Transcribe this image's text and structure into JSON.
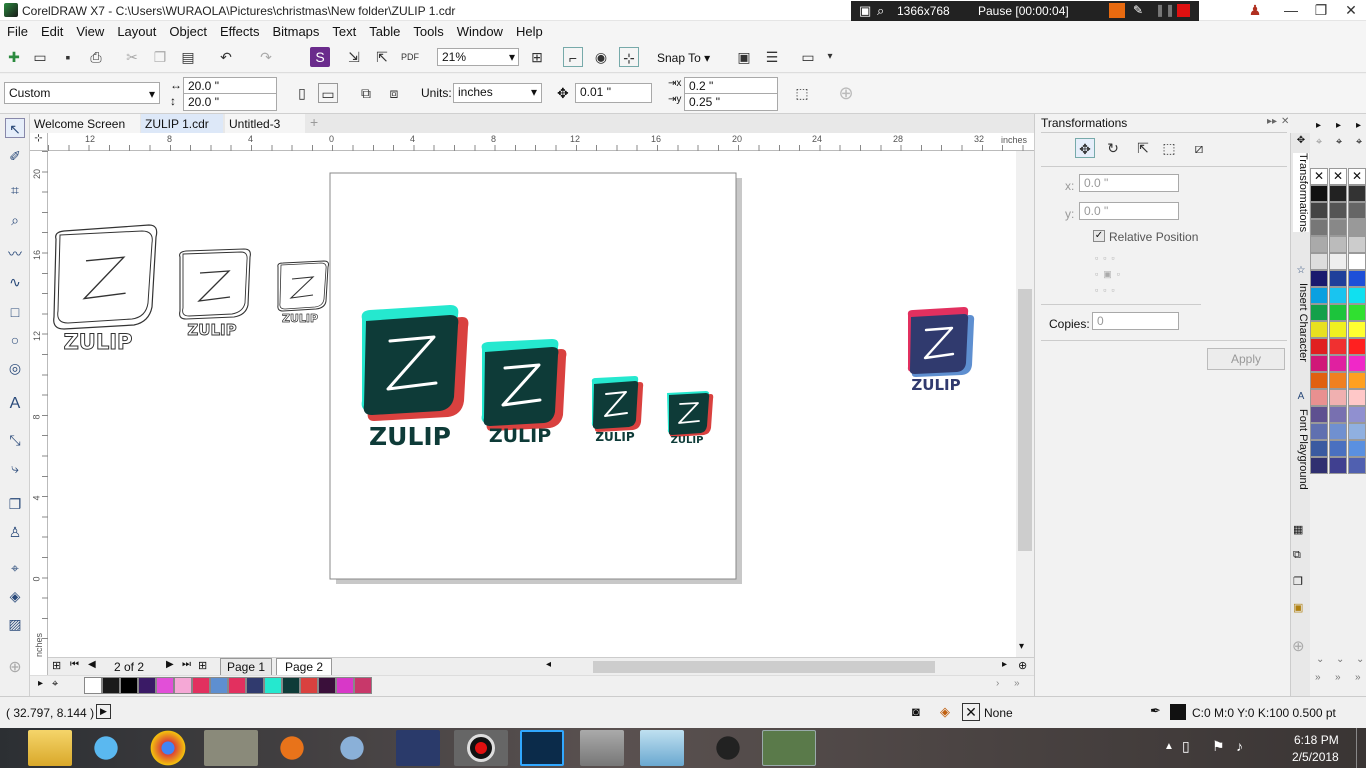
{
  "window": {
    "title": "CorelDRAW X7 - C:\\Users\\WURAOLA\\Pictures\\christmas\\New folder\\ZULIP 1.cdr",
    "recorder_resolution": "1366x768",
    "recorder_status": "Pause [00:00:04]"
  },
  "menu": [
    "File",
    "Edit",
    "View",
    "Layout",
    "Object",
    "Effects",
    "Bitmaps",
    "Text",
    "Table",
    "Tools",
    "Window",
    "Help"
  ],
  "toolbar": {
    "zoom_value": "21%",
    "snap_to_label": "Snap To"
  },
  "property_bar": {
    "preset": "Custom",
    "width": "20.0 \"",
    "height": "20.0 \"",
    "units_label": "Units:",
    "units_value": "inches",
    "nudge": "0.01 \"",
    "dup_x": "0.2 \"",
    "dup_y": "0.25 \""
  },
  "tabs": [
    "Welcome Screen",
    "ZULIP 1.cdr",
    "Untitled-3"
  ],
  "ruler": {
    "unit": "inches",
    "h_ticks": [
      "12",
      "8",
      "4",
      "0",
      "4",
      "8",
      "12",
      "16",
      "20",
      "24",
      "28",
      "32"
    ],
    "v_ticks": [
      "20",
      "16",
      "12",
      "8",
      "4",
      "0"
    ]
  },
  "logos": {
    "text": "ZULIP",
    "colors": {
      "teal": "#25e8cf",
      "dark": "#0e3b38",
      "red": "#d9413f",
      "pink": "#e2305f",
      "navy": "#303a6e",
      "blue": "#5e8fd0"
    }
  },
  "pages": {
    "counter": "2 of 2",
    "items": [
      "Page 1",
      "Page 2"
    ]
  },
  "docker": {
    "title": "Transformations",
    "x_label": "x:",
    "x_value": "0.0 \"",
    "y_label": "y:",
    "y_value": "0.0 \"",
    "relative_label": "Relative Position",
    "copies_label": "Copies:",
    "copies_value": "0",
    "apply_label": "Apply",
    "side_tabs": [
      "Transformations",
      "Insert Character",
      "Font Playground"
    ]
  },
  "status": {
    "coords": "( 32.797, 8.144 )",
    "fill": "None",
    "outline": "C:0 M:0 Y:0 K:100  0.500 pt"
  },
  "taskbar": {
    "time": "6:18 PM",
    "date": "2/5/2018"
  },
  "doc_palette": [
    "#ffffff",
    "#1a1a1a",
    "#000000",
    "#3a1a66",
    "#e24fd8",
    "#f5a8d6",
    "#e2305f",
    "#5e8fd0",
    "#e2305f",
    "#303a6e",
    "#25e8cf",
    "#0e3b38",
    "#d9413f",
    "#3a0f3a",
    "#d838c8",
    "#c8386a"
  ],
  "color_palette": [
    "#111111",
    "#222222",
    "#333333",
    "#444444",
    "#555555",
    "#666666",
    "#777777",
    "#888888",
    "#999999",
    "#aaaaaa",
    "#bbbbbb",
    "#cccccc",
    "#dddddd",
    "#eeeeee",
    "#ffffff",
    "#1a1a6e",
    "#1f3f9a",
    "#1d4fd8",
    "#0aa0e0",
    "#19c4f0",
    "#10e0f0",
    "#14a04a",
    "#1cc43c",
    "#30e030",
    "#e8e020",
    "#f0f020",
    "#ffff30",
    "#e02020",
    "#f03030",
    "#ff2020",
    "#d01878",
    "#e020a0",
    "#f028c8",
    "#e06010",
    "#f08020",
    "#ffa020",
    "#e89090",
    "#f0b0b0",
    "#ffc8c8",
    "#5e5090",
    "#7870b0",
    "#9090d0",
    "#6070b0",
    "#7090d0",
    "#90b0e0",
    "#3a5aa0",
    "#4a70c0",
    "#5a90e0",
    "#303070",
    "#404090",
    "#5060b0"
  ]
}
